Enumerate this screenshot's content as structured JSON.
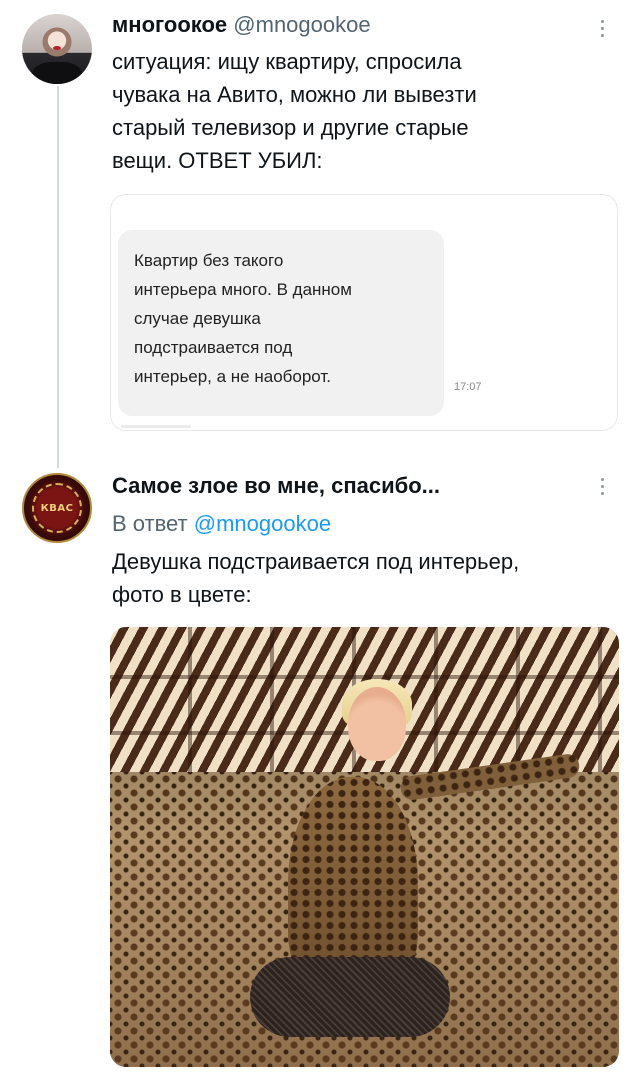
{
  "tweet1": {
    "name": "многоокое",
    "handle": "@mnogookoe",
    "text": "ситуация: ищу квартиру, спросила\nчувака на Авито, можно ли вывезти\nстарый телевизор и другие старые\nвещи. ОТВЕТ УБИЛ:",
    "attachment": {
      "message": "Квартир без такого\nинтерьера много. В данном\nслучае девушка\nподстраивается под\nинтерьер, а не наоборот.",
      "time": "17:07"
    }
  },
  "tweet2": {
    "name": "Самое злое во мне, спасибо...",
    "reply_prefix": "В ответ",
    "reply_mention": "@mnogookoe",
    "text": "Девушка подстраивается под интерьер,\nфото в цвете:",
    "avatar_text": "КВАС"
  },
  "icons": {
    "more": "more-vertical-icon"
  }
}
